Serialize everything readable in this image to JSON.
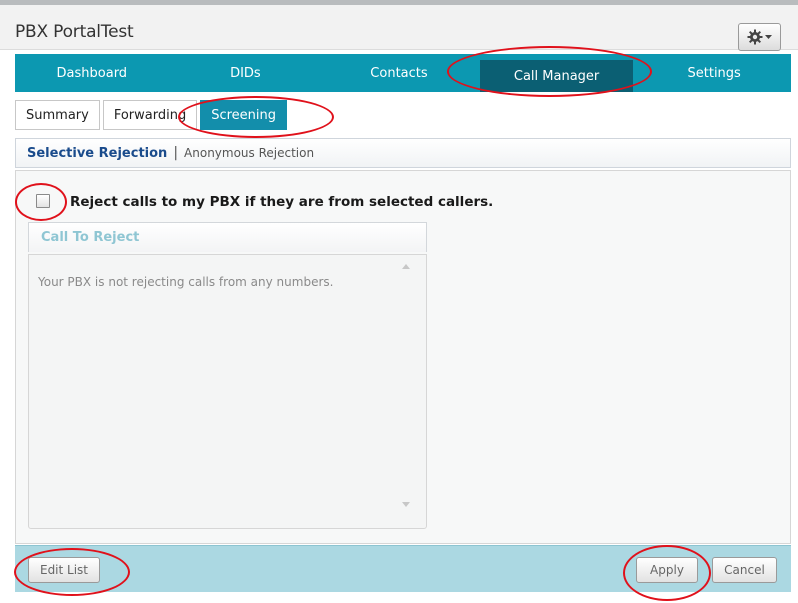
{
  "app": {
    "title": "PBX PortalTest"
  },
  "header": {
    "settings_icon": "gear-icon",
    "dropdown_icon": "chevron-down-icon"
  },
  "nav": {
    "tabs": [
      {
        "label": "Dashboard",
        "active": false
      },
      {
        "label": "DIDs",
        "active": false
      },
      {
        "label": "Contacts",
        "active": false
      },
      {
        "label": "Call Manager",
        "active": true
      },
      {
        "label": "Settings",
        "active": false
      }
    ]
  },
  "subtabs": [
    {
      "label": "Summary",
      "active": false
    },
    {
      "label": "Forwarding",
      "active": false
    },
    {
      "label": "Screening",
      "active": true
    }
  ],
  "section": {
    "selected": "Selective Rejection",
    "separator": "|",
    "other": "Anonymous Rejection"
  },
  "reject": {
    "checked": false,
    "label": "Reject calls to my PBX if they are from selected callers."
  },
  "list": {
    "header": "Call To Reject",
    "empty_message": "Your PBX is not rejecting calls from any numbers."
  },
  "footer": {
    "edit_label": "Edit List",
    "apply_label": "Apply",
    "cancel_label": "Cancel"
  },
  "colors": {
    "nav_background": "#0c98b1",
    "nav_active": "#0b5f73",
    "subtab_active": "#138eab",
    "footer_background": "#abd8e2",
    "annotation": "#e0111b"
  }
}
